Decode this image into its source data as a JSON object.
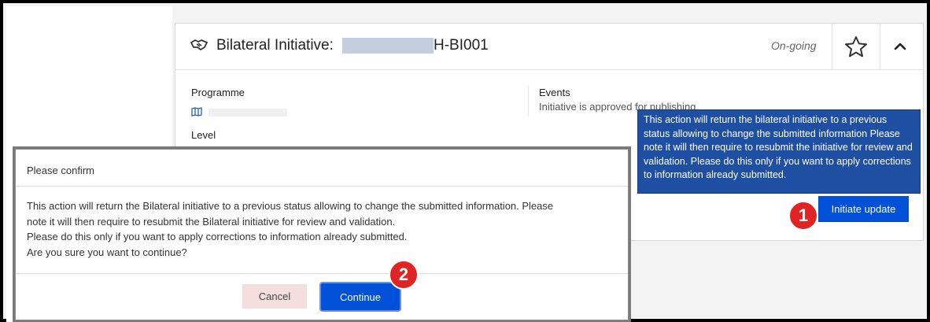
{
  "card": {
    "title_prefix": "Bilateral Initiative:",
    "title_suffix": "H-BI001",
    "status": "On-going",
    "programme_label": "Programme",
    "level_label": "Level",
    "events_label": "Events",
    "events_value": "Initiative is approved for publishing"
  },
  "tooltip": {
    "text": "This action will return the bilateral initiative to a previous status allowing to change the submitted information Please note it will then require to resubmit the initiative for review and validation. Please do this only if you want to apply corrections to information already submitted."
  },
  "initiate_button": {
    "label": "Initiate update"
  },
  "markers": {
    "first": "1",
    "second": "2"
  },
  "dialog": {
    "title": "Please confirm",
    "lines": [
      "This action will return the Bilateral initiative to a previous status allowing to change the submitted information. Please",
      "note it will then require to resubmit the Bilateral initiative for review and validation.",
      "Please do this only if you want to apply corrections to information already submitted.",
      "Are you sure you want to continue?"
    ],
    "cancel_label": "Cancel",
    "continue_label": "Continue"
  },
  "colors": {
    "primary_button": "#0050d8",
    "tooltip_bg": "#1f4fa3",
    "marker_red": "#e02424",
    "cancel_bg": "#f5dede"
  },
  "icons": [
    "handshake-icon",
    "star-icon",
    "chevron-up-icon",
    "map-icon"
  ]
}
